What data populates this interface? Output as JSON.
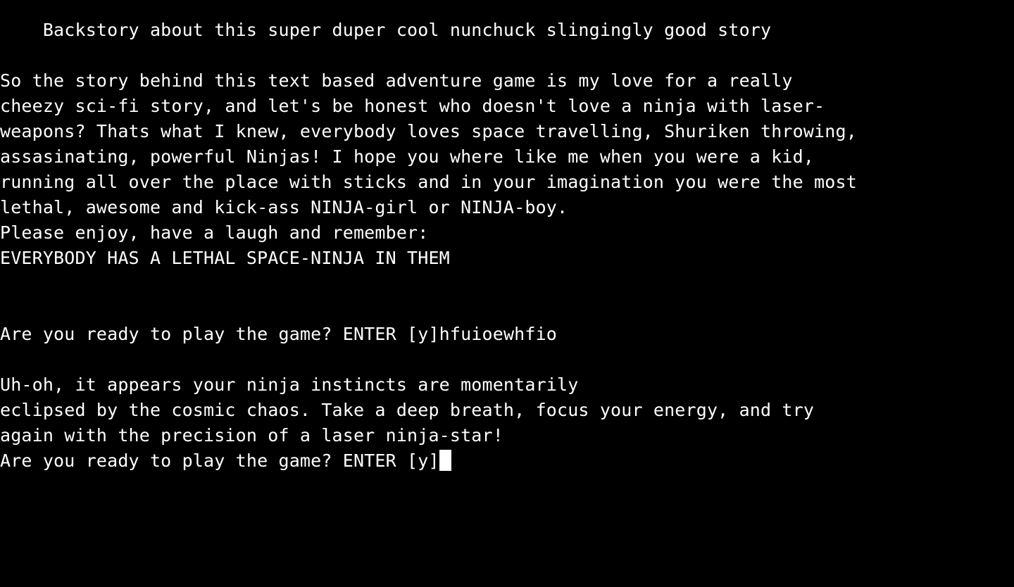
{
  "terminal": {
    "title": "    Backstory about this super duper cool nunchuck slingingly good story",
    "story_lines": [
      "So the story behind this text based adventure game is my love for a really",
      "cheezy sci-fi story, and let's be honest who doesn't love a ninja with laser-",
      "weapons? Thats what I knew, everybody loves space travelling, Shuriken throwing,",
      "assasinating, powerful Ninjas! I hope you where like me when you were a kid,",
      "running all over the place with sticks and in your imagination you were the most",
      "lethal, awesome and kick-ass NINJA-girl or NINJA-boy.",
      "Please enjoy, have a laugh and remember:",
      "EVERYBODY HAS A LETHAL SPACE-NINJA IN THEM"
    ],
    "first_prompt": "Are you ready to play the game? ENTER [y]",
    "first_input": "hfuioewhfio",
    "error_lines": [
      "Uh-oh, it appears your ninja instincts are momentarily",
      "eclipsed by the cosmic chaos. Take a deep breath, focus your energy, and try",
      "again with the precision of a laser ninja-star!"
    ],
    "current_prompt": "Are you ready to play the game? ENTER [y]",
    "current_input": ""
  }
}
